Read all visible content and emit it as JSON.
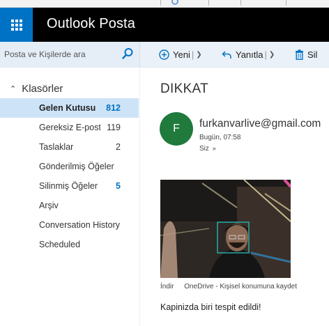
{
  "header": {
    "app_title": "Outlook Posta"
  },
  "search": {
    "placeholder": "Posta ve Kişilerde ara"
  },
  "toolbar": {
    "new_label": "Yeni",
    "reply_label": "Yanıtla",
    "delete_label": "Sil"
  },
  "sidebar": {
    "folders_label": "Klasörler",
    "items": [
      {
        "label": "Gelen Kutusu",
        "count": "812"
      },
      {
        "label": "Gereksiz E-posta",
        "count": "119"
      },
      {
        "label": "Taslaklar",
        "count": "2"
      },
      {
        "label": "Gönderilmiş Öğeler",
        "count": ""
      },
      {
        "label": "Silinmiş Öğeler",
        "count": "5"
      },
      {
        "label": "Arşiv",
        "count": ""
      },
      {
        "label": "Conversation History",
        "count": ""
      },
      {
        "label": "Scheduled",
        "count": ""
      }
    ]
  },
  "message": {
    "subject": "DIKKAT",
    "avatar_initial": "F",
    "sender": "furkanvarlive@gmail.com",
    "date": "Bugün, 07:58",
    "to": "Siz",
    "attachment_actions": {
      "download": "İndir",
      "onedrive": "OneDrive - Kişisel konumuna kaydet"
    },
    "body": "Kapinizda biri tespit edildi!"
  },
  "colors": {
    "brand_blue": "#0072c6",
    "topbar_bg": "#000000",
    "selected_folder_bg": "#cde4f8",
    "avatar_bg": "#1f7a3c",
    "detection_box": "#2ab3b0"
  }
}
